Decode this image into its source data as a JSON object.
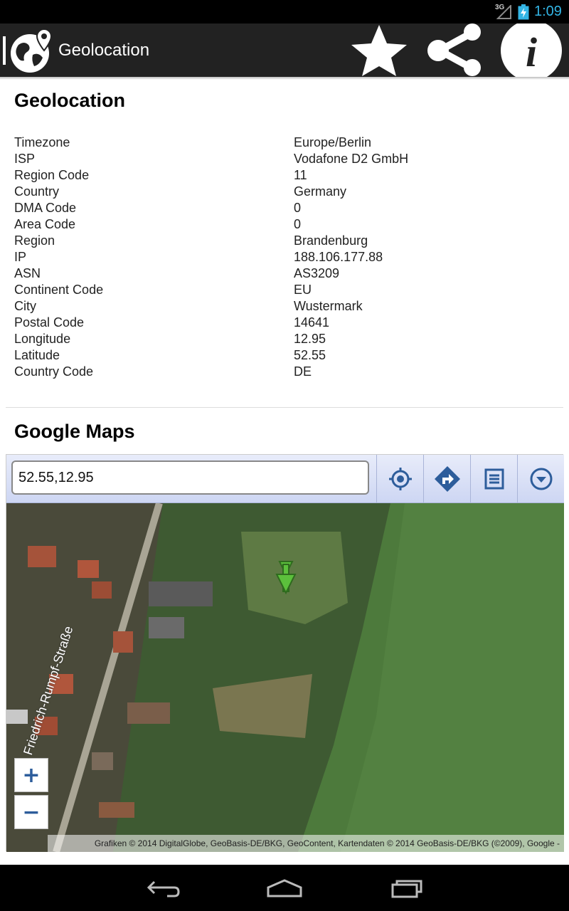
{
  "status": {
    "network": "3G",
    "time": "1:09"
  },
  "app": {
    "title": "Geolocation"
  },
  "sections": {
    "geolocation_title": "Geolocation",
    "maps_title": "Google Maps"
  },
  "info": [
    {
      "key": "Timezone",
      "value": "Europe/Berlin"
    },
    {
      "key": "ISP",
      "value": "Vodafone D2 GmbH"
    },
    {
      "key": "Region Code",
      "value": "11"
    },
    {
      "key": "Country",
      "value": "Germany"
    },
    {
      "key": "DMA Code",
      "value": "0"
    },
    {
      "key": "Area Code",
      "value": "0"
    },
    {
      "key": "Region",
      "value": "Brandenburg"
    },
    {
      "key": "IP",
      "value": "188.106.177.88"
    },
    {
      "key": "ASN",
      "value": "AS3209"
    },
    {
      "key": "Continent Code",
      "value": "EU"
    },
    {
      "key": "City",
      "value": "Wustermark"
    },
    {
      "key": "Postal Code",
      "value": "14641"
    },
    {
      "key": "Longitude",
      "value": "12.95"
    },
    {
      "key": "Latitude",
      "value": "52.55"
    },
    {
      "key": "Country Code",
      "value": "DE"
    }
  ],
  "map": {
    "search_value": "52.55,12.95",
    "zoom_in": "+",
    "zoom_out": "−",
    "street_label": "Friedrich-Rumpf-Straße",
    "attribution": "Grafiken © 2014 DigitalGlobe, GeoBasis-DE/BKG, GeoContent, Kartendaten © 2014 GeoBasis-DE/BKG (©2009), Google -"
  },
  "colors": {
    "accent": "#33b5e5",
    "action_bar": "#222222",
    "map_toolbar": "#d7def6",
    "map_icon": "#2d5d9b",
    "marker": "#5cc03c"
  }
}
